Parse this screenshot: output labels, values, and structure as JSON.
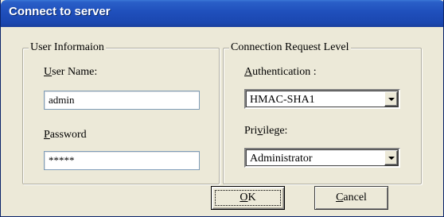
{
  "window": {
    "title": "Connect to server"
  },
  "user_info": {
    "legend": "User Informaion",
    "username_label_accel": "U",
    "username_label_rest": "ser Name:",
    "username_value": "admin",
    "password_label_accel": "P",
    "password_label_rest": "assword",
    "password_value": "*****"
  },
  "connection": {
    "legend": "Connection  Request Level",
    "auth_label_accel": "A",
    "auth_label_rest": "uthentication :",
    "auth_selected": "HMAC-SHA1",
    "priv_label_pre": "Pri",
    "priv_label_accel": "v",
    "priv_label_rest": "ilege:",
    "priv_selected": "Administrator"
  },
  "buttons": {
    "ok_accel": "O",
    "ok_rest": "K",
    "cancel_accel": "C",
    "cancel_rest": "ancel"
  },
  "colors": {
    "titlebar": "#1f4fbb",
    "face": "#ece9d8",
    "field_border": "#7f9db9"
  }
}
